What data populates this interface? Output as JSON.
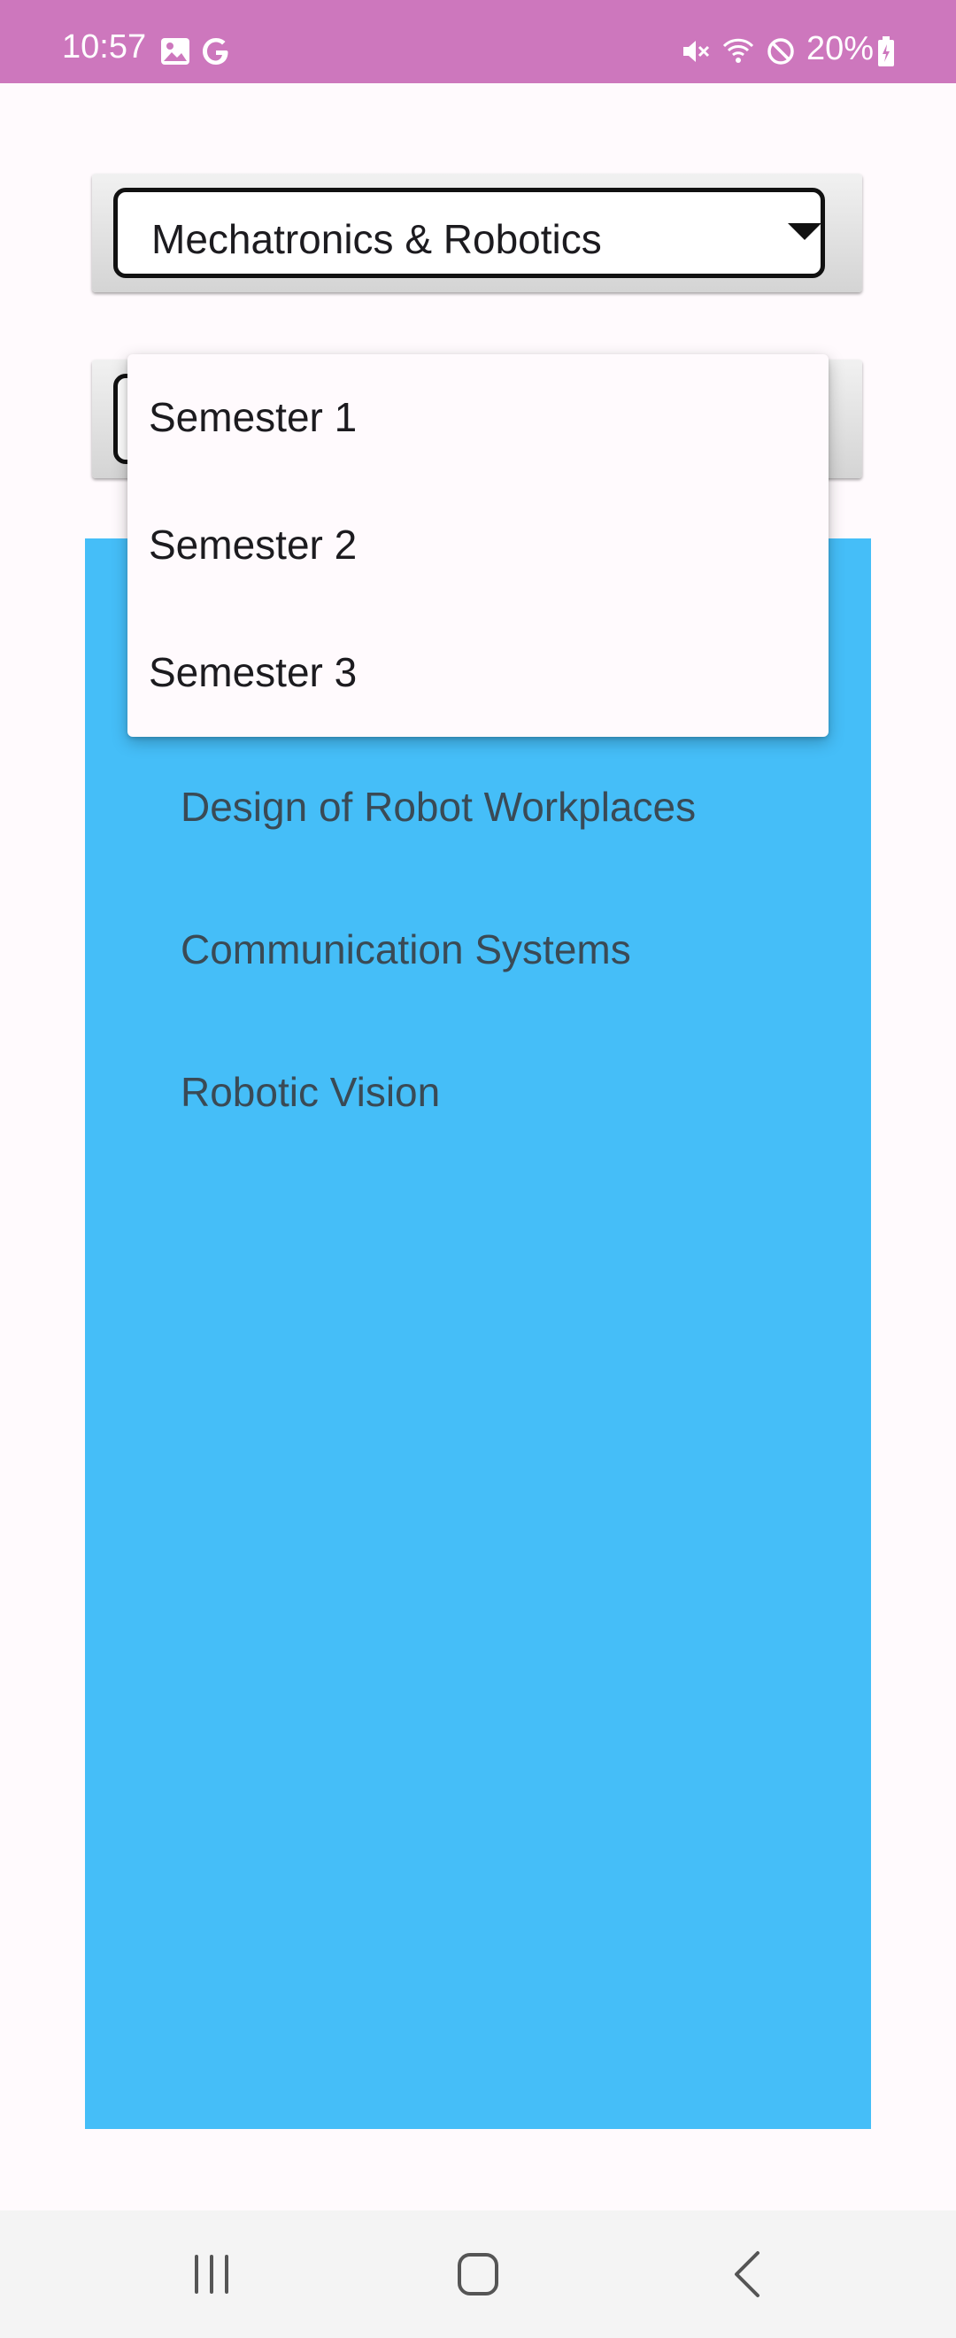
{
  "status_bar": {
    "time": "10:57",
    "battery": "20%",
    "icons": [
      "image-icon",
      "google-icon",
      "mute-icon",
      "wifi-icon",
      "blocked-icon",
      "battery-charging-icon"
    ]
  },
  "program_spinner": {
    "selected": "Mechatronics & Robotics"
  },
  "semester_dropdown": {
    "options": [
      "Semester 1",
      "Semester 2",
      "Semester 3"
    ]
  },
  "course_list": {
    "items": [
      "Design of Robot Workplaces",
      "Communication Systems",
      "Robotic Vision"
    ]
  },
  "nav_bar": {
    "buttons": [
      "recents-icon",
      "home-icon",
      "back-icon"
    ]
  },
  "colors": {
    "status_bar": "#cd77bd",
    "panel": "#45bef8",
    "background": "#fffafd"
  }
}
